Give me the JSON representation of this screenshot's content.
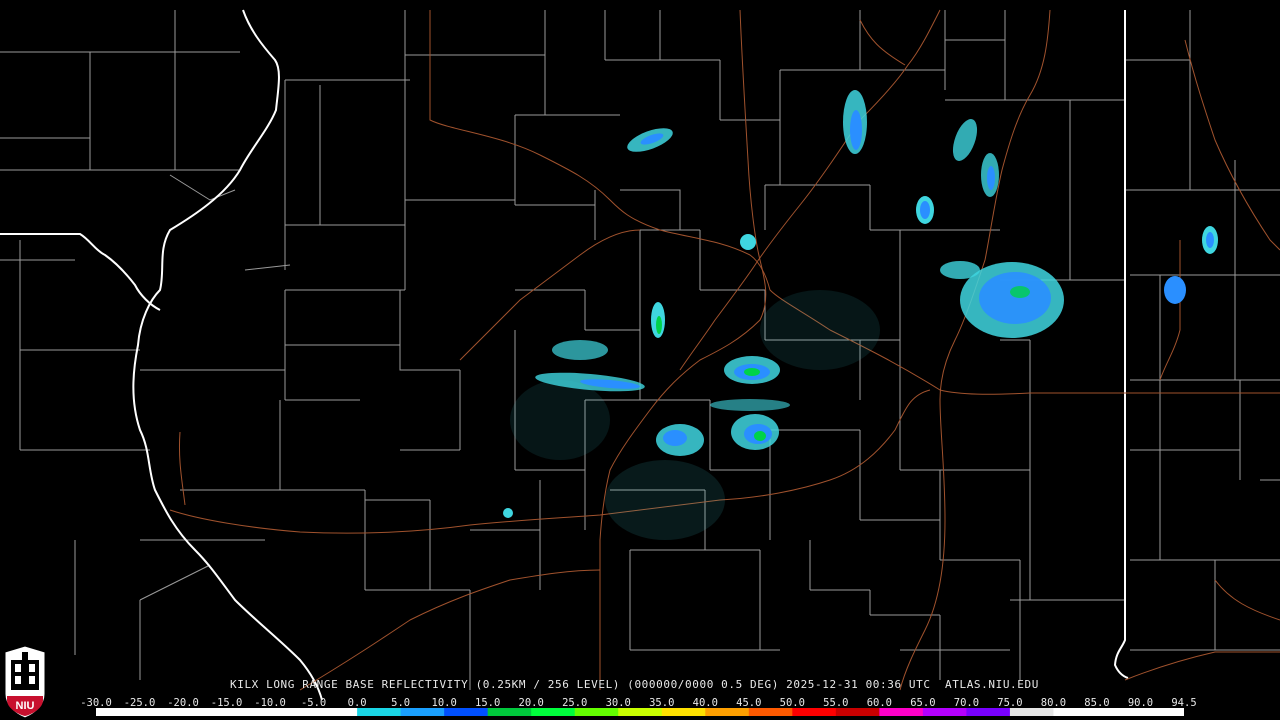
{
  "caption": {
    "product": "KILX LONG RANGE BASE REFLECTIVITY (0.25KM / 256 LEVEL) (000000/0000 0.5 DEG) 2025-12-31 00:36 UTC  ATLAS.NIU.EDU"
  },
  "logo": {
    "text": "NIU"
  },
  "color_scale": {
    "labels": [
      "-30.0",
      "-25.0",
      "-20.0",
      "-15.0",
      "-10.0",
      "-5.0",
      "0.0",
      "5.0",
      "10.0",
      "15.0",
      "20.0",
      "25.0",
      "30.0",
      "35.0",
      "40.0",
      "45.0",
      "50.0",
      "55.0",
      "60.0",
      "65.0",
      "70.0",
      "75.0",
      "80.0",
      "85.0",
      "90.0",
      "94.5"
    ],
    "colors": [
      "#ffffff",
      "#ffffff",
      "#ffffff",
      "#ffffff",
      "#ffffff",
      "#ffffff",
      "#1ad6e6",
      "#1aa0ff",
      "#0050ff",
      "#00c83c",
      "#00ff3c",
      "#64ff00",
      "#c8ff00",
      "#ffe100",
      "#ffa000",
      "#ff5a00",
      "#ff0000",
      "#c80000",
      "#ff00c8",
      "#b400ff",
      "#7800ff",
      "#e6e6e6",
      "#ffffff",
      "#ffffff",
      "#ffffff"
    ]
  },
  "colors": {
    "background": "#000000",
    "county_lines": "#9a9a9a",
    "state_lines": "#ffffff",
    "roads": "#a0522d",
    "echo_light": "#3fd6e0",
    "echo_mid": "#2a8fff",
    "echo_strong": "#00d24a"
  }
}
